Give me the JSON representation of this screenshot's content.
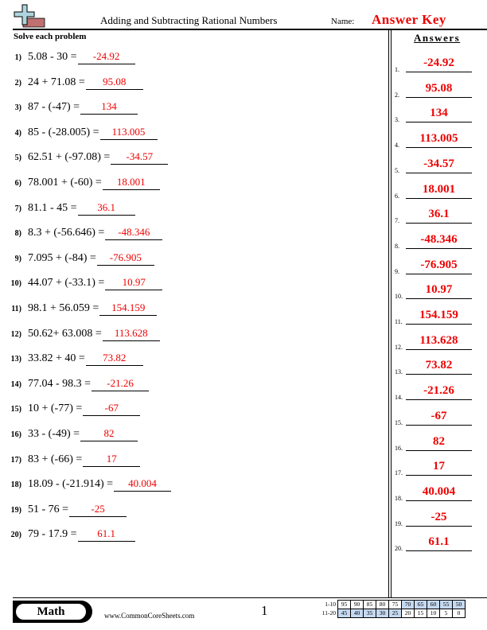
{
  "header": {
    "title": "Adding and Subtracting Rational Numbers",
    "name_label": "Name:",
    "name_value": "Answer Key",
    "logo_icon": "plus-minus-icon"
  },
  "instructions": "Solve each problem",
  "answers_heading": "Answers",
  "problems": [
    {
      "num": "1)",
      "expr": "5.08 - 30 =",
      "answer": "-24.92"
    },
    {
      "num": "2)",
      "expr": "24 + 71.08 =",
      "answer": "95.08"
    },
    {
      "num": "3)",
      "expr": "87 - (-47) =",
      "answer": "134"
    },
    {
      "num": "4)",
      "expr": "85 - (-28.005) =",
      "answer": "113.005"
    },
    {
      "num": "5)",
      "expr": "62.51 + (-97.08) =",
      "answer": "-34.57"
    },
    {
      "num": "6)",
      "expr": "78.001 + (-60) =",
      "answer": "18.001"
    },
    {
      "num": "7)",
      "expr": "81.1 - 45 =",
      "answer": "36.1"
    },
    {
      "num": "8)",
      "expr": "8.3 + (-56.646) =",
      "answer": "-48.346"
    },
    {
      "num": "9)",
      "expr": "7.095 + (-84) =",
      "answer": "-76.905"
    },
    {
      "num": "10)",
      "expr": "44.07 + (-33.1) =",
      "answer": "10.97"
    },
    {
      "num": "11)",
      "expr": "98.1 + 56.059 =",
      "answer": "154.159"
    },
    {
      "num": "12)",
      "expr": "50.62+ 63.008 =",
      "answer": "113.628"
    },
    {
      "num": "13)",
      "expr": "33.82 + 40 =",
      "answer": "73.82"
    },
    {
      "num": "14)",
      "expr": "77.04 - 98.3 =",
      "answer": "-21.26"
    },
    {
      "num": "15)",
      "expr": "10 + (-77) =",
      "answer": "-67"
    },
    {
      "num": "16)",
      "expr": "33 - (-49) =",
      "answer": "82"
    },
    {
      "num": "17)",
      "expr": "83 + (-66) =",
      "answer": "17"
    },
    {
      "num": "18)",
      "expr": "18.09 - (-21.914) =",
      "answer": "40.004"
    },
    {
      "num": "19)",
      "expr": "51 - 76 =",
      "answer": "-25"
    },
    {
      "num": "20)",
      "expr": "79 - 17.9 =",
      "answer": "61.1"
    }
  ],
  "answer_key": [
    {
      "num": "1.",
      "value": "-24.92"
    },
    {
      "num": "2.",
      "value": "95.08"
    },
    {
      "num": "3.",
      "value": "134"
    },
    {
      "num": "4.",
      "value": "113.005"
    },
    {
      "num": "5.",
      "value": "-34.57"
    },
    {
      "num": "6.",
      "value": "18.001"
    },
    {
      "num": "7.",
      "value": "36.1"
    },
    {
      "num": "8.",
      "value": "-48.346"
    },
    {
      "num": "9.",
      "value": "-76.905"
    },
    {
      "num": "10.",
      "value": "10.97"
    },
    {
      "num": "11.",
      "value": "154.159"
    },
    {
      "num": "12.",
      "value": "113.628"
    },
    {
      "num": "13.",
      "value": "73.82"
    },
    {
      "num": "14.",
      "value": "-21.26"
    },
    {
      "num": "15.",
      "value": "-67"
    },
    {
      "num": "16.",
      "value": "82"
    },
    {
      "num": "17.",
      "value": "17"
    },
    {
      "num": "18.",
      "value": "40.004"
    },
    {
      "num": "19.",
      "value": "-25"
    },
    {
      "num": "20.",
      "value": "61.1"
    }
  ],
  "footer": {
    "subject": "Math",
    "website": "www.CommonCoreSheets.com",
    "page": "1",
    "score_table": {
      "rows": [
        {
          "label": "1-10",
          "scores": [
            "95",
            "90",
            "85",
            "80",
            "75",
            "70",
            "65",
            "60",
            "55",
            "50"
          ],
          "highlighted": [
            false,
            false,
            false,
            false,
            false,
            true,
            true,
            true,
            true,
            true
          ]
        },
        {
          "label": "11-20",
          "scores": [
            "45",
            "40",
            "35",
            "30",
            "25",
            "20",
            "15",
            "10",
            "5",
            "0"
          ],
          "highlighted": [
            true,
            true,
            true,
            true,
            true,
            false,
            false,
            false,
            false,
            false
          ]
        }
      ]
    }
  },
  "colors": {
    "answer_red": "#ee0000",
    "highlight_blue": "#c5d9f1",
    "logo_cross": "#aed6df",
    "logo_bar": "#c07070"
  }
}
